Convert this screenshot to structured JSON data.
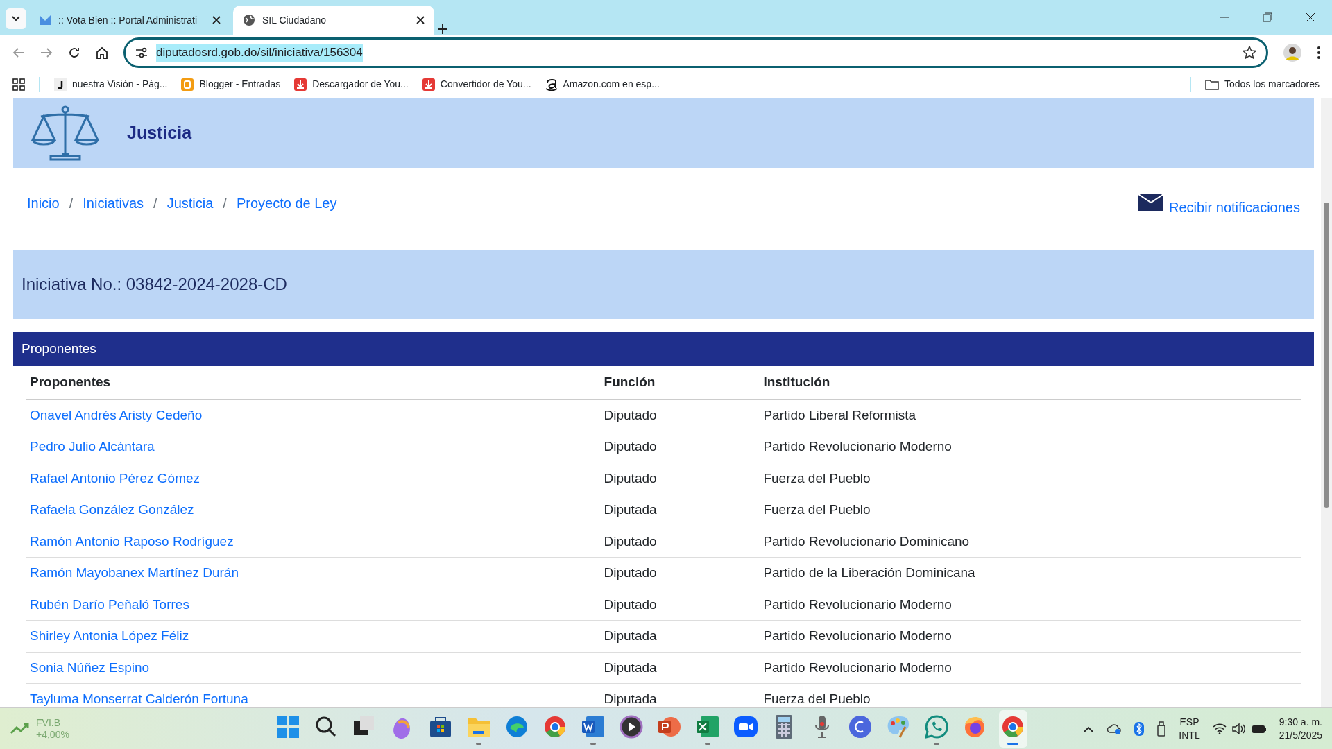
{
  "browser": {
    "tabs": [
      {
        "title": ":: Vota Bien :: Portal Administrati",
        "selected": false
      },
      {
        "title": "SIL Ciudadano",
        "selected": true
      }
    ],
    "url": "diputadosrd.gob.do/sil/iniciativa/156304",
    "bookmarks": [
      "nuestra Visión - Pág...",
      "Blogger - Entradas",
      "Descargador de You...",
      "Convertidor de You...",
      "Amazon.com en esp..."
    ],
    "all_bookmarks": "Todos los marcadores"
  },
  "page": {
    "section_title": "Justicia",
    "breadcrumb": [
      "Inicio",
      "Iniciativas",
      "Justicia",
      "Proyecto de Ley"
    ],
    "breadcrumb_separator": "/",
    "notify_link": "Recibir notificaciones",
    "initiative_title": "Iniciativa No.: 03842-2024-2028-CD",
    "panel_title": "Proponentes",
    "table": {
      "columns": [
        "Proponentes",
        "Función",
        "Institución"
      ],
      "rows": [
        [
          "Onavel Andrés Aristy Cedeño",
          "Diputado",
          "Partido Liberal Reformista"
        ],
        [
          "Pedro Julio Alcántara",
          "Diputado",
          "Partido Revolucionario Moderno"
        ],
        [
          "Rafael Antonio Pérez Gómez",
          "Diputado",
          "Fuerza del Pueblo"
        ],
        [
          "Rafaela González González",
          "Diputada",
          "Fuerza del Pueblo"
        ],
        [
          "Ramón Antonio Raposo Rodríguez",
          "Diputado",
          "Partido Revolucionario Dominicano"
        ],
        [
          "Ramón Mayobanex Martínez Durán",
          "Diputado",
          "Partido de la Liberación Dominicana"
        ],
        [
          "Rubén Darío Peñaló Torres",
          "Diputado",
          "Partido Revolucionario Moderno"
        ],
        [
          "Shirley Antonia López Féliz",
          "Diputada",
          "Partido Revolucionario Moderno"
        ],
        [
          "Sonia Núñez Espino",
          "Diputada",
          "Partido Revolucionario Moderno"
        ],
        [
          "Tayluma Monserrat Calderón Fortuna",
          "Diputada",
          "Fuerza del Pueblo"
        ]
      ]
    }
  },
  "taskbar": {
    "stock": {
      "symbol": "FVI.B",
      "change": "+4,00%"
    },
    "apps": [
      {
        "kind": "start",
        "running": false,
        "selected": false
      },
      {
        "kind": "search",
        "running": false,
        "selected": false
      },
      {
        "kind": "taskview",
        "running": false,
        "selected": false
      },
      {
        "kind": "copilot",
        "running": false,
        "selected": false
      },
      {
        "kind": "store",
        "running": false,
        "selected": false
      },
      {
        "kind": "folder",
        "running": true,
        "selected": false
      },
      {
        "kind": "edge",
        "running": false,
        "selected": false
      },
      {
        "kind": "chrome",
        "running": false,
        "selected": false
      },
      {
        "kind": "word",
        "running": true,
        "selected": false
      },
      {
        "kind": "play",
        "running": false,
        "selected": false
      },
      {
        "kind": "powerpoint",
        "running": false,
        "selected": false
      },
      {
        "kind": "excel",
        "running": true,
        "selected": false
      },
      {
        "kind": "zoom",
        "running": false,
        "selected": false
      },
      {
        "kind": "calculator",
        "running": false,
        "selected": false
      },
      {
        "kind": "microphone",
        "running": false,
        "selected": false
      },
      {
        "kind": "canva",
        "running": false,
        "selected": false
      },
      {
        "kind": "paint",
        "running": false,
        "selected": false
      },
      {
        "kind": "whatsapp",
        "running": true,
        "selected": false
      },
      {
        "kind": "firefox",
        "running": false,
        "selected": false
      },
      {
        "kind": "chrome",
        "running": true,
        "selected": true
      }
    ],
    "language": [
      "ESP",
      "INTL"
    ],
    "time": "9:30 a. m.",
    "date": "21/5/2025"
  }
}
